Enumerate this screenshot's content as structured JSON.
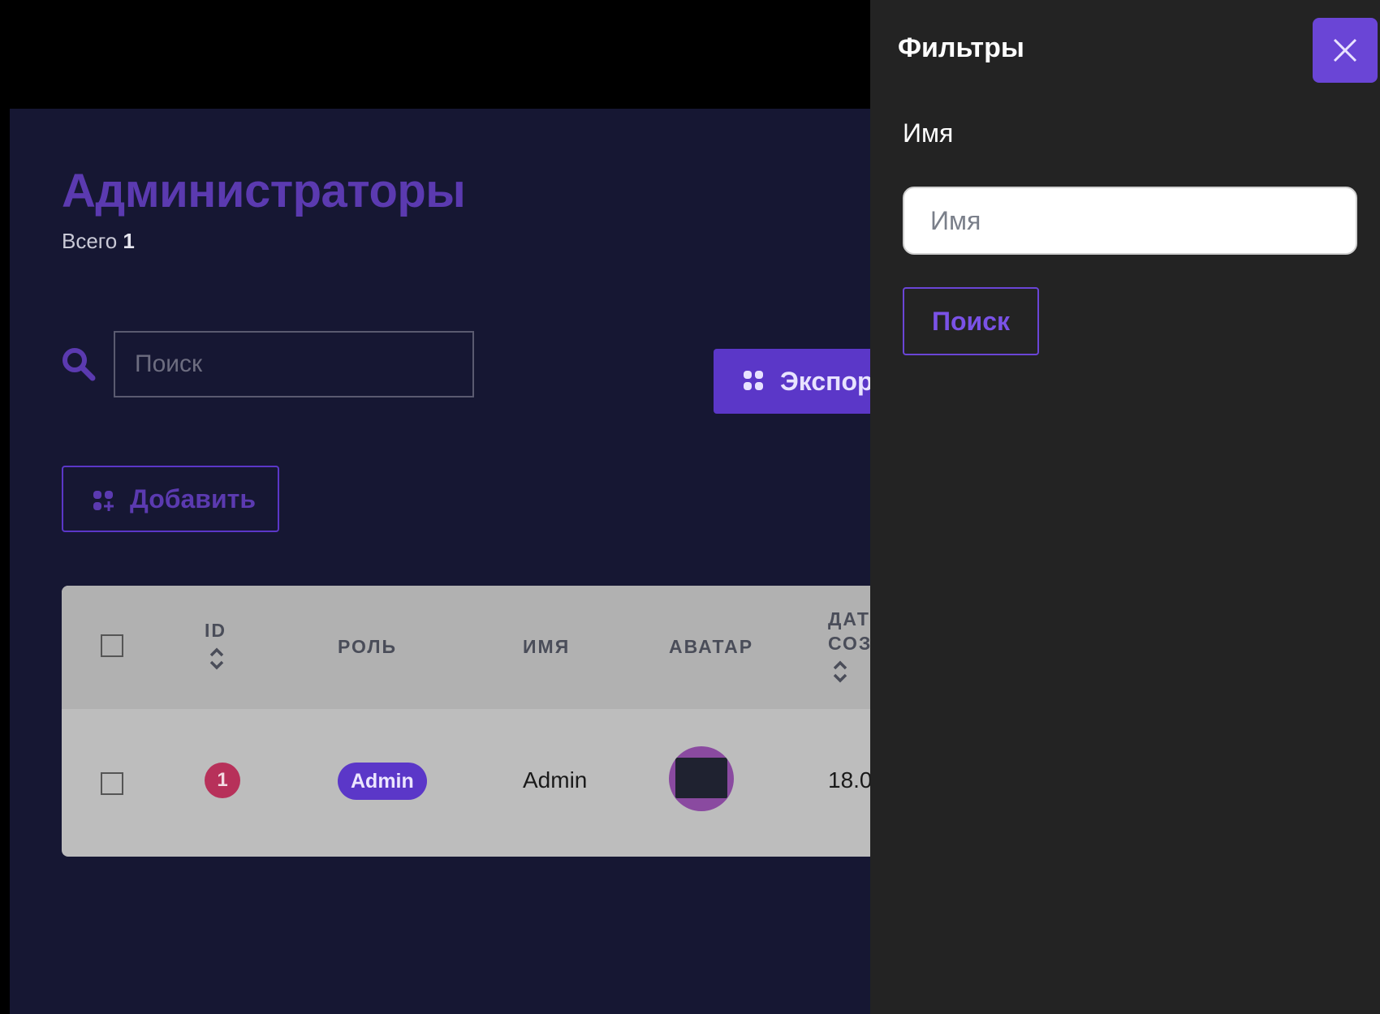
{
  "page": {
    "title": "Администраторы",
    "total_label": "Всего",
    "total_count": "1"
  },
  "toolbar": {
    "search_placeholder": "Поиск",
    "export_label": "Экспор",
    "add_label": "Добавить"
  },
  "table": {
    "columns": [
      "ID",
      "РОЛЬ",
      "ИМЯ",
      "АВАТАР",
      "ДАТ",
      "СОЗ"
    ],
    "rows": [
      {
        "id": "1",
        "role": "Admin",
        "name": "Admin",
        "date": "18.0"
      }
    ]
  },
  "filters": {
    "title": "Фильтры",
    "name_label": "Имя",
    "name_placeholder": "Имя",
    "search_label": "Поиск"
  },
  "colors": {
    "accent": "#5b37c8",
    "badge_red": "#b7315a",
    "main_bg": "#161733",
    "drawer_bg": "#232323"
  }
}
